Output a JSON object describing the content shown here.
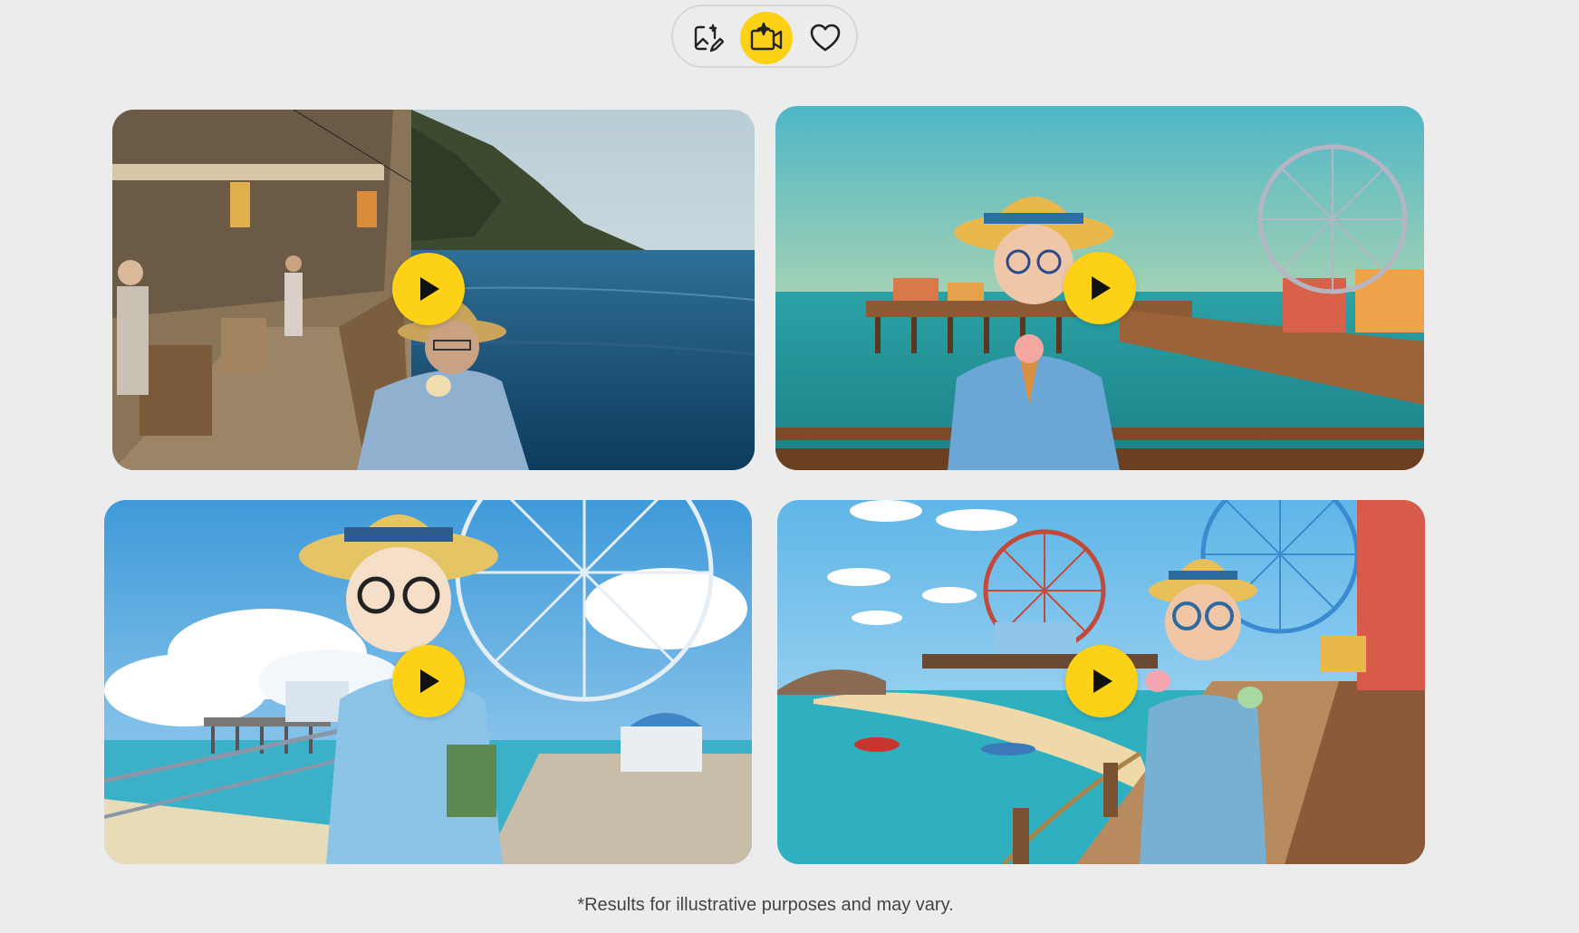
{
  "toolbar": {
    "buttons": [
      {
        "icon": "image-edit-icon",
        "active": false
      },
      {
        "icon": "video-sparkle-icon",
        "active": true
      },
      {
        "icon": "heart-icon",
        "active": false
      }
    ],
    "accent_color": "#fcd116"
  },
  "cards": [
    {
      "style": "photorealistic",
      "icon": "play-icon"
    },
    {
      "style": "pixel-art",
      "icon": "play-icon"
    },
    {
      "style": "anime",
      "icon": "play-icon"
    },
    {
      "style": "3d-clay",
      "icon": "play-icon"
    }
  ],
  "footer": {
    "disclaimer": "*Results for illustrative purposes and may vary."
  }
}
